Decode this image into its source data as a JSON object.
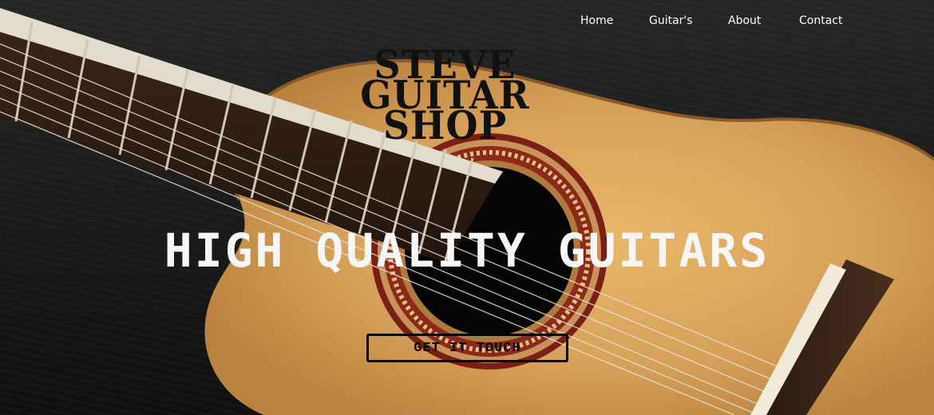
{
  "nav": {
    "items": [
      {
        "label": "Home"
      },
      {
        "label": "Guitar's"
      },
      {
        "label": "About"
      },
      {
        "label": "Contact"
      }
    ]
  },
  "logo": {
    "lines": [
      "STEVE",
      "GUITAR",
      "SHOP"
    ]
  },
  "hero": {
    "headline": "HIGH QUALITY GUITARS",
    "cta_label": "GET IT TOUCH"
  },
  "colors": {
    "background": "#1a1a1a",
    "guitar_wood": "#d9a45a",
    "text_light": "#ffffff",
    "text_dark": "#111111"
  }
}
